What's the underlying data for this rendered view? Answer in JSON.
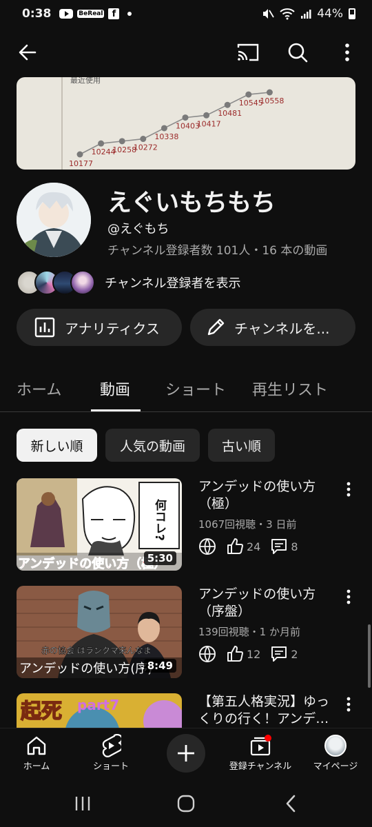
{
  "status_bar": {
    "time": "0:38",
    "bereal": "BeReal",
    "facebook": "f",
    "battery": "44%"
  },
  "channel": {
    "name": "えぐいもちもち",
    "handle": "@えぐもち",
    "stats": "チャンネル登録者数 101人・16 本の動画",
    "view_subscribers": "チャンネル登録者を表示"
  },
  "banner": {
    "caption": "最近使用",
    "points": [
      10177,
      10244,
      10258,
      10272,
      10338,
      10403,
      10417,
      10481,
      10545,
      10558
    ]
  },
  "actions": {
    "analytics": "アナリティクス",
    "edit_channel": "チャンネルを..."
  },
  "tabs": [
    {
      "label": "ホーム"
    },
    {
      "label": "動画"
    },
    {
      "label": "ショート"
    },
    {
      "label": "再生リスト"
    }
  ],
  "active_tab": "動画",
  "chips": [
    {
      "label": "新しい順"
    },
    {
      "label": "人気の動画"
    },
    {
      "label": "古い順"
    }
  ],
  "videos": [
    {
      "title": "アンデッドの使い方（極）",
      "meta": "1067回視聴・3 日前",
      "likes": "24",
      "comments": "8",
      "duration": "5:30",
      "thumb_text": "アンデッドの使い方（極）",
      "thumb_bubble": "何コレ?"
    },
    {
      "title": "アンデッドの使い方（序盤）",
      "meta": "139回視聴・1 か月前",
      "likes": "12",
      "comments": "2",
      "duration": "8:49",
      "thumb_text": "アンデッドの使い方(序)",
      "thumb_sub": "赤の協会 はランクマ来んなま"
    },
    {
      "title": "【第五人格実況】ゆっくりの行く！アンデ…",
      "thumb_text": "起死",
      "thumb_part": "part7"
    }
  ],
  "bottom_nav": [
    {
      "label": "ホーム",
      "icon": "home-icon"
    },
    {
      "label": "ショート",
      "icon": "shorts-icon"
    },
    {
      "label": "",
      "icon": "plus-icon"
    },
    {
      "label": "登録チャンネル",
      "icon": "subscriptions-icon"
    },
    {
      "label": "マイページ",
      "icon": "avatar-icon"
    }
  ],
  "colors": {
    "background": "#0f0f0f",
    "chip": "#272727",
    "accent_red": "#ff0000",
    "text_secondary": "#aaaaaa"
  }
}
